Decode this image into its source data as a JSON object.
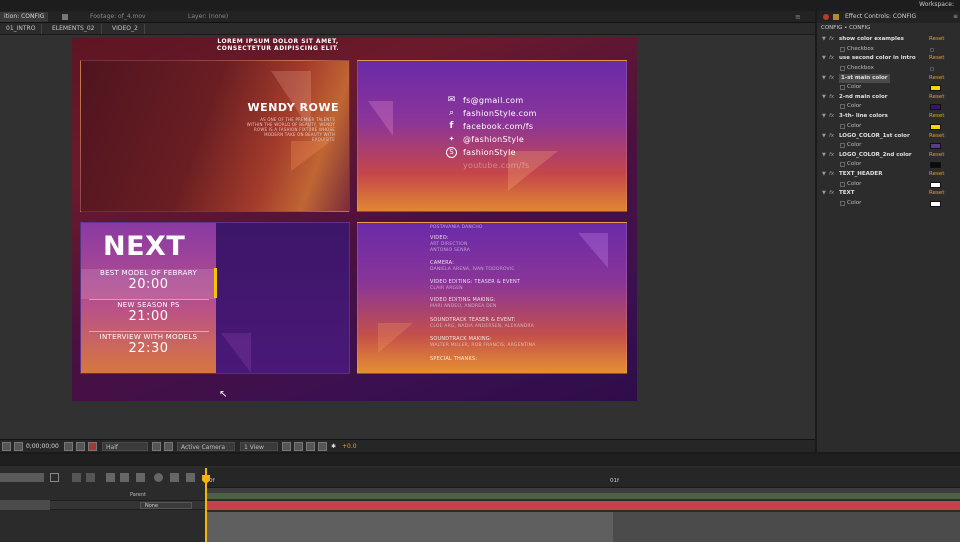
{
  "topbar": {
    "workspace_label": "Workspace:"
  },
  "tabs": {
    "composition": "ition: CONFIG",
    "footage": "Footage: of_4.mov",
    "layer": "Layer: (none)"
  },
  "breadcrumbs": [
    "01_INTRO",
    "ELEMENTS_02",
    "VIDEO_2"
  ],
  "comp": {
    "headline": "LOREM IPSUM DOLOR SIT AMET,\nCONSECTETUR ADIPISCING ELIT.",
    "profile": {
      "name": "WENDY ROWE",
      "bio": "AS ONE OF THE PREMIER TALENTS WITHIN THE WORLD OF BEAUTY, WENDY ROWE IS A FASHION FIXTURE WHOSE MODERN TAKE ON BEAUTY WITH EXQUISITE"
    },
    "social": [
      {
        "icon": "mail-icon",
        "glyph": "✉",
        "text": "fs@gmail.com"
      },
      {
        "icon": "search-icon",
        "glyph": "⌕",
        "text": "fashionStyle.com"
      },
      {
        "icon": "facebook-icon",
        "glyph": "f",
        "text": "facebook.com/fs"
      },
      {
        "icon": "twitter-icon",
        "glyph": "🐦",
        "text": "@fashionStyle"
      },
      {
        "icon": "skype-icon",
        "glyph": "S",
        "text": "fashionStyle"
      },
      {
        "icon": "youtube-icon",
        "glyph": "",
        "text": "youtube.com/fs"
      }
    ],
    "next": {
      "title": "NEXT",
      "events": [
        {
          "label": "BEST MODEL OF FEBRARY",
          "time": "20:00"
        },
        {
          "label": "NEW SEASON PS",
          "time": "21:00"
        },
        {
          "label": "INTERVIEW WITH MODELS",
          "time": "22:30"
        }
      ]
    },
    "credits": [
      {
        "text": "POSTAVANIA DANCHO",
        "hd": false
      },
      {
        "text": "VIDEO:",
        "hd": true
      },
      {
        "text": "ART DIRECTION",
        "hd": false
      },
      {
        "text": "ANTONIO SENRA",
        "hd": false
      },
      {
        "text": "CAMERA:",
        "hd": true
      },
      {
        "text": "DANIELA ARENA, IVAN TODOROVIC",
        "hd": false
      },
      {
        "text": "VIDEO EDITING: TEASER & EVENT",
        "hd": true
      },
      {
        "text": "CLAIR ARGEN",
        "hd": false
      },
      {
        "text": "VIDEO EDITING MAKING:",
        "hd": true
      },
      {
        "text": "MARI ANDEO, ANDREA DEN",
        "hd": false
      },
      {
        "text": "SOUNDTRACK TEASER & EVENT:",
        "hd": true
      },
      {
        "text": "CLOE ARG, NADIA ANDERSEN, ALEXANDRA",
        "hd": false
      },
      {
        "text": "SOUNDTRACK MAKING:",
        "hd": true
      },
      {
        "text": "WALTER MILLER, ROB FRANCIS, ARGENTINA",
        "hd": false
      },
      {
        "text": "SPECIAL THANKS:",
        "hd": true
      }
    ]
  },
  "viewer_controls": {
    "timecode": "0;00;00;00",
    "resolution": "Half",
    "camera": "Active Camera",
    "views": "1 View",
    "exposure": "+0.0"
  },
  "effects_panel": {
    "title": "Effect Controls: CONFIG",
    "subtitle": "CONFIG • CONFIG",
    "reset_label": "Reset",
    "effects": [
      {
        "name": "show color examples",
        "sub": "Checkbox",
        "kind": "checkbox",
        "highlight": false
      },
      {
        "name": "use second color in intro",
        "sub": "Checkbox",
        "kind": "checkbox",
        "highlight": false
      },
      {
        "name": "1-st main color",
        "sub": "Color",
        "kind": "color",
        "color": "#f5d800",
        "highlight": true
      },
      {
        "name": "2-nd main color",
        "sub": "Color",
        "kind": "color",
        "color": "#3c0f7a",
        "highlight": false
      },
      {
        "name": "3-th- line colors",
        "sub": "Color",
        "kind": "color",
        "color": "#f5d800",
        "highlight": false
      },
      {
        "name": "LOGO_COLOR_1st color",
        "sub": "Color",
        "kind": "color",
        "color": "#5a3a8a",
        "highlight": false
      },
      {
        "name": "LOGO_COLOR_2nd color",
        "sub": "Color",
        "kind": "color",
        "color": "#0a0a0a",
        "highlight": false
      },
      {
        "name": "TEXT_HEADER",
        "sub": "Color",
        "kind": "color",
        "color": "#ffffff",
        "highlight": false
      },
      {
        "name": "TEXT",
        "sub": "Color",
        "kind": "color",
        "color": "#ffffff",
        "highlight": false
      }
    ]
  },
  "timeline": {
    "ruler_start": "0f",
    "ruler_mark": "01f",
    "parent_header": "Parent",
    "parent_value": "None"
  },
  "colors": {
    "accent": "#f4b400",
    "layer_bar": "#c4434b",
    "reset": "#e0a133"
  }
}
